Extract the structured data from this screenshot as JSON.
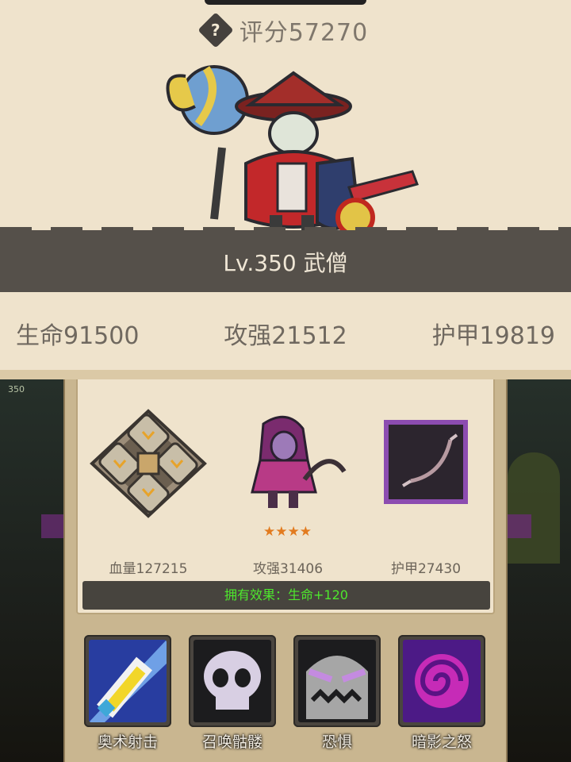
{
  "header": {
    "help_icon": "?",
    "score": "评分57270",
    "title": "Lv.350 武僧",
    "stats": [
      "生命91500",
      "攻强21512",
      "护甲19819"
    ]
  },
  "background": {
    "level_tag": "350"
  },
  "equipment": {
    "items": [
      {
        "name": "rune-shield",
        "label": "血量127215"
      },
      {
        "name": "pet-hero",
        "label": "攻强31406",
        "stars": "★★★★"
      },
      {
        "name": "purple-bow",
        "label": "护甲27430"
      }
    ],
    "effect": "拥有效果：生命+120"
  },
  "skills": [
    {
      "name": "arcane-shot",
      "label": "奥术射击"
    },
    {
      "name": "summon-skeleton",
      "label": "召唤骷髅"
    },
    {
      "name": "fear",
      "label": "恐惧"
    },
    {
      "name": "shadow-rage",
      "label": "暗影之怒"
    }
  ],
  "colors": {
    "effect_text": "#4ee72d",
    "star": "#e27b1f",
    "band": "#55504a",
    "panel": "#efe3cc"
  }
}
